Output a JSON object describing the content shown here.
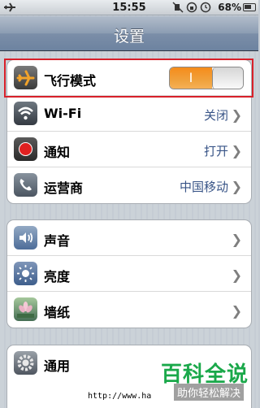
{
  "status_bar": {
    "time": "15:55",
    "battery_percent": "68%"
  },
  "nav": {
    "title": "设置"
  },
  "group1": {
    "airplane": {
      "label": "飞行模式",
      "toggle_on_text": "I",
      "toggle_state": "on",
      "icon": "airplane-icon"
    },
    "wifi": {
      "label": "Wi-Fi",
      "value": "关闭",
      "icon": "wifi-icon"
    },
    "notifications": {
      "label": "通知",
      "value": "打开",
      "icon": "notification-icon"
    },
    "carrier": {
      "label": "运营商",
      "value": "中国移动",
      "icon": "phone-icon"
    }
  },
  "group2": {
    "sounds": {
      "label": "声音",
      "icon": "speaker-icon"
    },
    "brightness": {
      "label": "亮度",
      "icon": "sun-icon"
    },
    "wallpaper": {
      "label": "墙纸",
      "icon": "flower-icon"
    }
  },
  "group3": {
    "general": {
      "label": "通用",
      "icon": "gear-icon"
    }
  },
  "watermark": {
    "brand": "百科全说",
    "tagline": "助你轻松解决"
  },
  "url_fragment": "http://www.ha",
  "colors": {
    "highlight_border": "#d8202a",
    "toggle_on": "#f58b1b",
    "value_text": "#385487"
  }
}
